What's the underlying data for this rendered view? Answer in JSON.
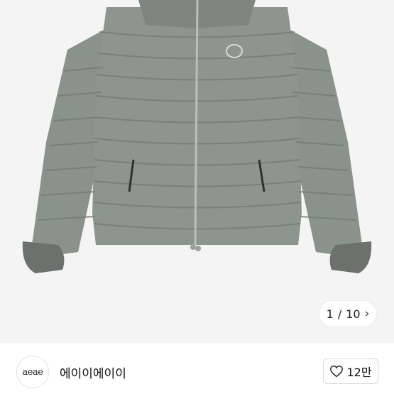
{
  "gallery": {
    "current_page": "1",
    "separator": "/",
    "total_pages": "10"
  },
  "seller": {
    "avatar_text": "aeae",
    "name": "에이이에이이"
  },
  "likes": {
    "count": "12만"
  },
  "colors": {
    "jacket": "#8a938b",
    "jacket_shadow": "#717a72",
    "cuff": "#6d716d"
  }
}
